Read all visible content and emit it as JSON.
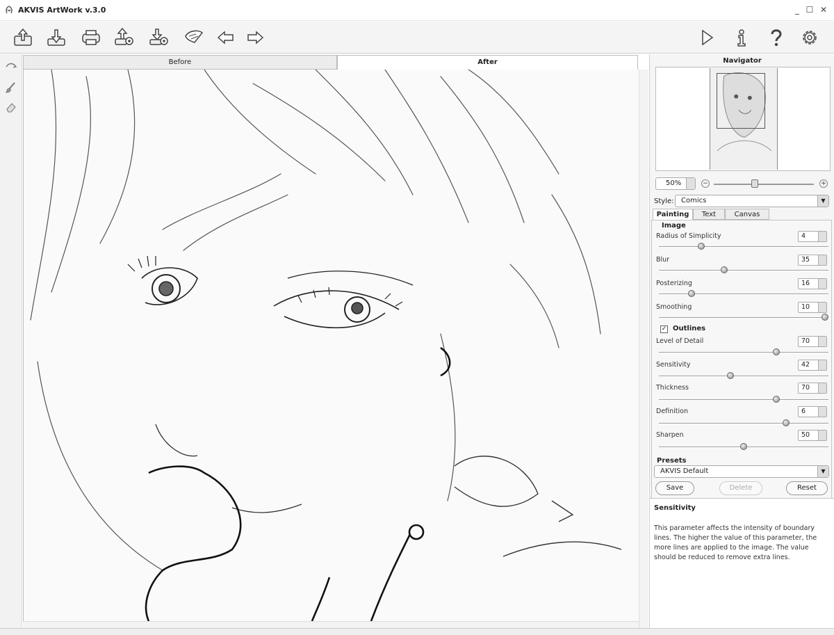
{
  "window": {
    "title": "AKVIS ArtWork v.3.0",
    "controls": {
      "minimize": "_",
      "maximize": "☐",
      "close": "✕"
    }
  },
  "toolbar": {
    "left_buttons": [
      "open-icon",
      "save-icon",
      "print-icon",
      "export-settings-icon",
      "import-settings-icon",
      "brush-icon",
      "undo-icon",
      "redo-icon"
    ],
    "right_buttons": [
      "run-icon",
      "info-icon",
      "help-icon",
      "settings-icon"
    ]
  },
  "tools": [
    "direction-tool-icon",
    "brush-tool-icon",
    "eraser-tool-icon"
  ],
  "view_tabs": {
    "before": "Before",
    "after": "After",
    "active": "After"
  },
  "navigator": {
    "title": "Navigator",
    "zoom": "50%",
    "zoom_minus": "−",
    "zoom_plus": "+",
    "zoom_level_fraction": 0.4
  },
  "style": {
    "label": "Style:",
    "value": "Comics"
  },
  "param_tabs": [
    "Painting",
    "Text",
    "Canvas"
  ],
  "active_param_tab": "Painting",
  "image_group": {
    "title": "Image",
    "params": [
      {
        "label": "Radius of Simplicity",
        "value": "4",
        "fraction": 0.24
      },
      {
        "label": "Blur",
        "value": "35",
        "fraction": 0.38
      },
      {
        "label": "Posterizing",
        "value": "16",
        "fraction": 0.18
      },
      {
        "label": "Smoothing",
        "value": "10",
        "fraction": 1.0
      }
    ]
  },
  "outlines_group": {
    "title": "Outlines",
    "checked": "✓",
    "params": [
      {
        "label": "Level of Detail",
        "value": "70",
        "fraction": 0.7
      },
      {
        "label": "Sensitivity",
        "value": "42",
        "fraction": 0.42
      },
      {
        "label": "Thickness",
        "value": "70",
        "fraction": 0.7
      },
      {
        "label": "Definition",
        "value": "6",
        "fraction": 0.76
      },
      {
        "label": "Sharpen",
        "value": "50",
        "fraction": 0.5
      }
    ]
  },
  "presets": {
    "title": "Presets",
    "selected": "AKVIS Default",
    "save": "Save",
    "delete": "Delete",
    "reset": "Reset"
  },
  "help": {
    "title": "Sensitivity",
    "text": "This parameter affects the intensity of boundary lines. The higher the value of this parameter, the more lines are applied to the image. The value should be reduced to remove extra lines."
  }
}
